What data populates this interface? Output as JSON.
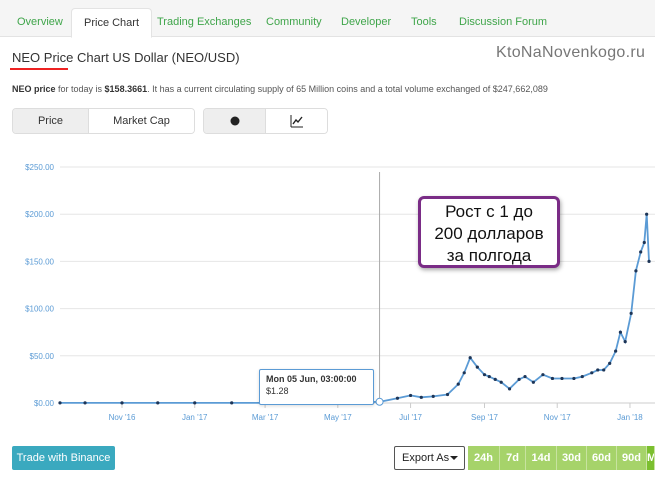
{
  "tabs": [
    {
      "label": "Overview",
      "active": false
    },
    {
      "label": "Price Chart",
      "active": true
    },
    {
      "label": "Trading Exchanges",
      "active": false
    },
    {
      "label": "Community",
      "active": false
    },
    {
      "label": "Developer",
      "active": false
    },
    {
      "label": "Tools",
      "active": false
    },
    {
      "label": "Discussion Forum",
      "active": false
    }
  ],
  "watermark": "KtoNaNovenkogo.ru",
  "page_title": "NEO Price Chart US Dollar (NEO/USD)",
  "description": {
    "coin": "NEO price",
    "pre": " for today is ",
    "price": "$158.3661",
    "post": ". It has a current circulating supply of 65 Million coins and a total volume exchanged of $247,662,089"
  },
  "toggle_metric": {
    "options": [
      "Price",
      "Market Cap"
    ],
    "selected": "Price"
  },
  "toggle_view": {
    "options": [
      "dot-icon",
      "line-chart-icon"
    ],
    "selected": "dot-icon"
  },
  "chart_data": {
    "type": "line",
    "y_ticks": [
      "$250.00",
      "$200.00",
      "$150.00",
      "$100.00",
      "$50.00",
      "$0.00"
    ],
    "ylim": [
      0,
      250
    ],
    "x_ticks": [
      "Nov '16",
      "Jan '17",
      "Mar '17",
      "May '17",
      "Jul '17",
      "Sep '17",
      "Nov '17",
      "Jan '18"
    ],
    "x": [
      "2016-09-10",
      "2016-10-01",
      "2016-11-01",
      "2016-12-01",
      "2017-01-01",
      "2017-02-01",
      "2017-03-01",
      "2017-04-01",
      "2017-05-01",
      "2017-06-05",
      "2017-06-20",
      "2017-07-01",
      "2017-07-10",
      "2017-07-20",
      "2017-08-01",
      "2017-08-10",
      "2017-08-15",
      "2017-08-20",
      "2017-08-26",
      "2017-09-01",
      "2017-09-05",
      "2017-09-10",
      "2017-09-15",
      "2017-09-22",
      "2017-09-30",
      "2017-10-05",
      "2017-10-12",
      "2017-10-20",
      "2017-10-28",
      "2017-11-05",
      "2017-11-15",
      "2017-11-22",
      "2017-11-30",
      "2017-12-05",
      "2017-12-10",
      "2017-12-15",
      "2017-12-20",
      "2017-12-24",
      "2017-12-28",
      "2018-01-02",
      "2018-01-06",
      "2018-01-10",
      "2018-01-13",
      "2018-01-15",
      "2018-01-17"
    ],
    "values": [
      0.1,
      0.1,
      0.1,
      0.1,
      0.1,
      0.1,
      0.1,
      0.1,
      0.3,
      1.28,
      5,
      8,
      6,
      7,
      9,
      20,
      32,
      48,
      38,
      30,
      28,
      25,
      22,
      15,
      25,
      28,
      22,
      30,
      26,
      26,
      26,
      28,
      32,
      35,
      35,
      42,
      55,
      75,
      65,
      95,
      140,
      160,
      170,
      200,
      150
    ],
    "tooltip": {
      "date": "Mon 05 Jun, 03:00:00",
      "value": "$1.28"
    },
    "line_color": "#5b9bd5",
    "grid": true
  },
  "annotation": {
    "line1": "Рост с 1 до",
    "line2": "200 долларов",
    "line3": "за полгода"
  },
  "buttons": {
    "trade": "Trade with Binance",
    "export": "Export As"
  },
  "ranges": [
    "24h",
    "7d",
    "14d",
    "30d",
    "60d",
    "90d",
    "M"
  ],
  "colors": {
    "accent": "#3fa54a",
    "range_bg": "#a6d36a",
    "binance": "#3aa9bf",
    "callout_border": "#7a2c86"
  }
}
